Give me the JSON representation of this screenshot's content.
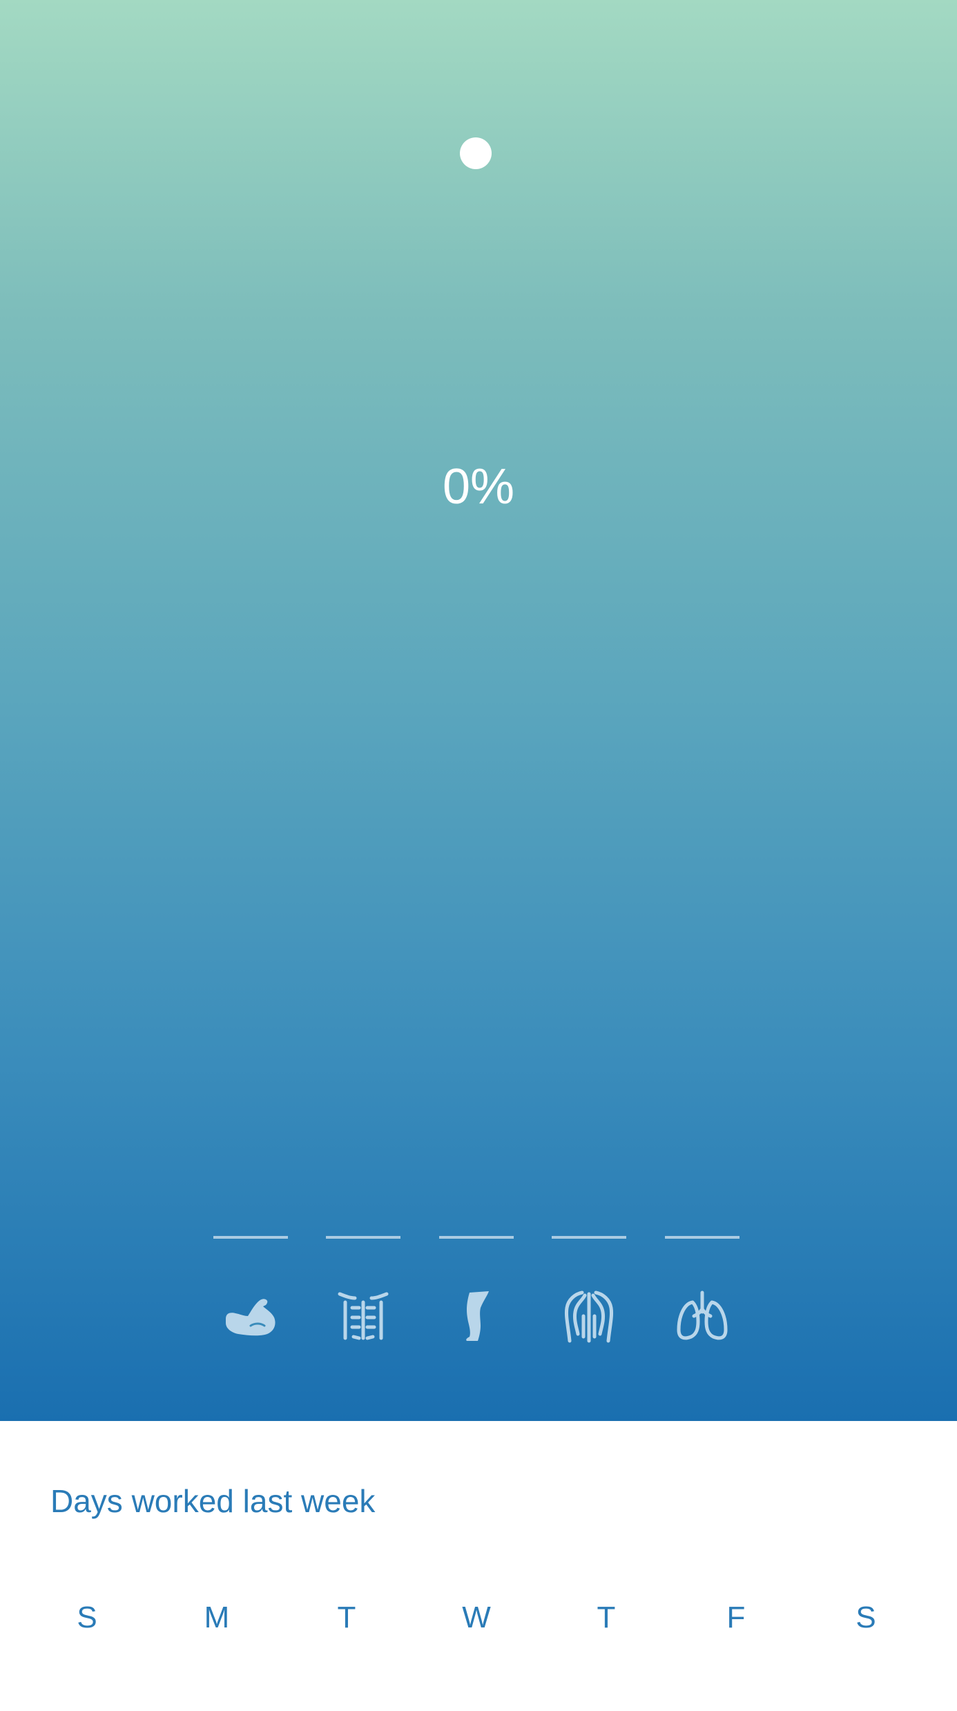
{
  "progress": {
    "percent_label": "0%",
    "value": 0
  },
  "categories": [
    {
      "name": "arms",
      "icon": "bicep-icon"
    },
    {
      "name": "abs",
      "icon": "abs-icon"
    },
    {
      "name": "legs",
      "icon": "leg-icon"
    },
    {
      "name": "back",
      "icon": "back-icon"
    },
    {
      "name": "cardio",
      "icon": "lungs-icon"
    }
  ],
  "week": {
    "title": "Days worked last week",
    "days": [
      "S",
      "M",
      "T",
      "W",
      "T",
      "F",
      "S"
    ]
  },
  "colors": {
    "gradient_top": "#a3d9c2",
    "gradient_bottom": "#1a6fb0",
    "accent": "#2a7bb7",
    "icon_tint": "#b9d6ea"
  }
}
